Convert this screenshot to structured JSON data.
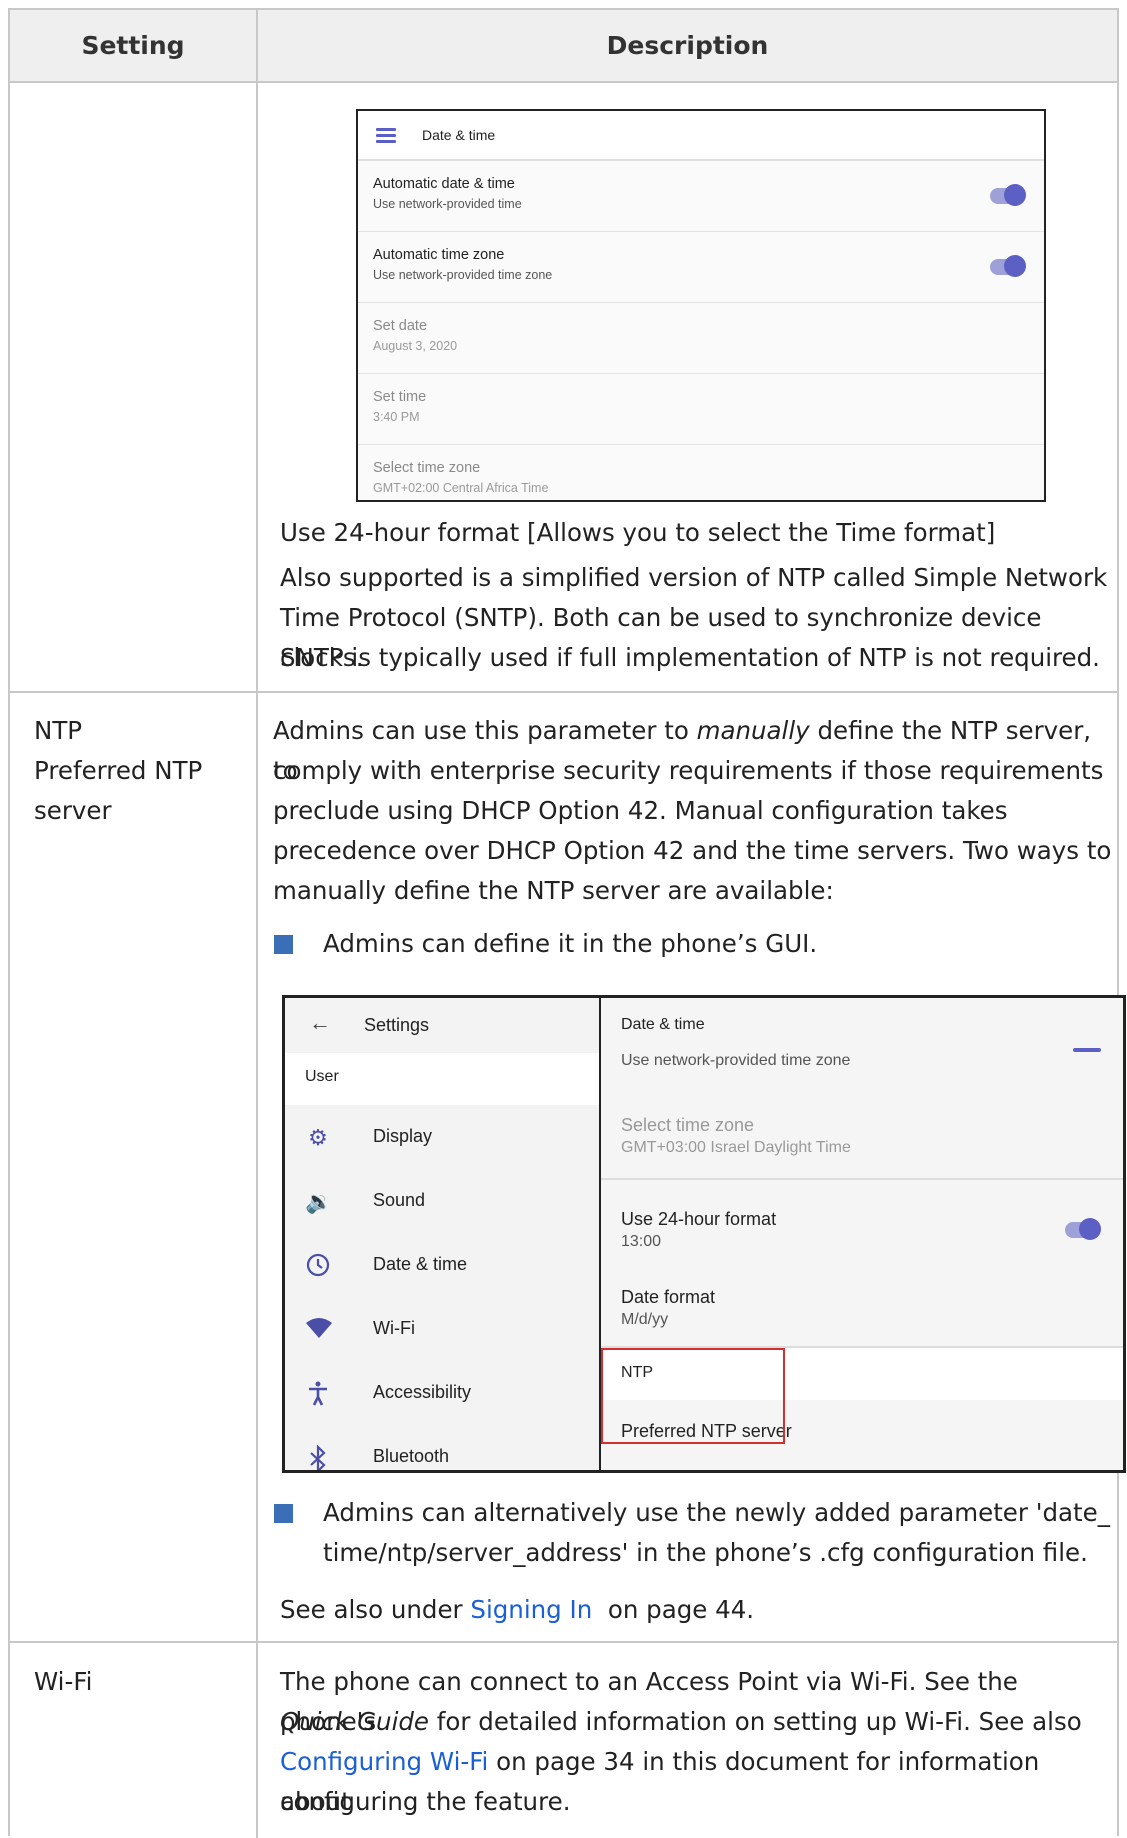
{
  "header": {
    "col_setting": "Setting",
    "col_description": "Description"
  },
  "row1": {
    "screenshot": {
      "title": "Date & time",
      "items": [
        {
          "title": "Automatic date & time",
          "subtitle": "Use network-provided time",
          "toggle": true,
          "enabled": true
        },
        {
          "title": "Automatic time zone",
          "subtitle": "Use network-provided time zone",
          "toggle": true,
          "enabled": true
        },
        {
          "title": "Set date",
          "subtitle": "August 3, 2020",
          "toggle": false,
          "enabled": false
        },
        {
          "title": "Set time",
          "subtitle": "3:40 PM",
          "toggle": false,
          "enabled": false
        },
        {
          "title": "Select time zone",
          "subtitle": "GMT+02:00 Central Africa Time",
          "toggle": false,
          "enabled": false
        }
      ]
    },
    "line1": "Use 24-hour format [Allows you to select the Time format]",
    "para": [
      "Also supported is a simplified version of NTP called Simple Network",
      "Time Protocol (SNTP). Both can be used to synchronize device clocks.",
      "SNTP is typically used if full implementation of NTP is not required."
    ]
  },
  "row2": {
    "setting_lines": [
      "NTP",
      "Preferred NTP",
      "server"
    ],
    "desc": {
      "l1_pre": "Admins can use this parameter to ",
      "l1_em": "manually",
      "l1_post": " define the NTP server, to",
      "l2": "comply with enterprise security requirements if those requirements",
      "l3": "preclude using DHCP Option 42. Manual configuration takes",
      "l4": "precedence over DHCP Option 42 and the time servers. Two ways to",
      "l5": "manually define the NTP server are available:"
    },
    "bullet1": "Admins can define it in the phone’s GUI.",
    "screenshot": {
      "left_title": "Settings",
      "section": "User",
      "menu": [
        {
          "icon": "display-icon",
          "label": "Display"
        },
        {
          "icon": "sound-icon",
          "label": "Sound"
        },
        {
          "icon": "clock-icon",
          "label": "Date & time"
        },
        {
          "icon": "wifi-icon",
          "label": "Wi-Fi"
        },
        {
          "icon": "accessibility-icon",
          "label": "Accessibility"
        },
        {
          "icon": "bluetooth-icon",
          "label": "Bluetooth"
        }
      ],
      "right_title": "Date & time",
      "r_partial": "Use network-provided time zone",
      "r_tz_title": "Select time zone",
      "r_tz_sub": "GMT+03:00 Israel Daylight Time",
      "r_24_title": "Use 24-hour format",
      "r_24_sub": "13:00",
      "r_df_title": "Date format",
      "r_df_sub": "M/d/yy",
      "r_ntp": "NTP",
      "r_pref": "Preferred NTP server",
      "highlight_color": "#d32f2f"
    },
    "bullet2_l1": "Admins can alternatively use the newly added parameter 'date_",
    "bullet2_l2": "time/ntp/server_address' in the phone’s .cfg configuration file.",
    "see_pre": "See also under ",
    "see_link": "Signing In",
    "see_post": "  on page 44."
  },
  "row3": {
    "setting": "Wi-Fi",
    "l1": "The phone can connect to an Access Point via Wi-Fi. See the phone's",
    "l2_em": "Quick Guide",
    "l2_post": " for detailed information on setting up Wi-Fi. See also",
    "l3_link": "Configuring Wi-Fi",
    "l3_post": " on page 34 in this document for information about",
    "l4": "configuring the feature."
  },
  "colors": {
    "accent": "#5c5fc3",
    "link": "#1a5fd4",
    "bullet": "#3a6fb8",
    "border": "#c8c8c8"
  }
}
